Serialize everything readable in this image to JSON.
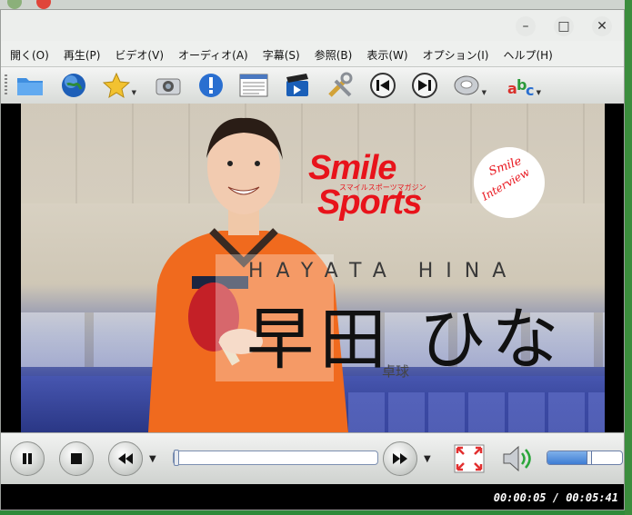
{
  "menu": [
    "開く(O)",
    "再生(P)",
    "ビデオ(V)",
    "オーディオ(A)",
    "字幕(S)",
    "参照(B)",
    "表示(W)",
    "オプション(I)",
    "ヘルプ(H)"
  ],
  "window_buttons": {
    "minimize": "–",
    "maximize": "□",
    "close": "✕"
  },
  "toolbar_icons": [
    "open-folder-icon",
    "globe-icon",
    "favorites-star-icon",
    "screenshot-camera-icon",
    "info-icon",
    "playlist-icon",
    "settings-clapper-icon",
    "preferences-tools-icon",
    "previous-icon",
    "next-icon",
    "audio-disc-icon",
    "subtitles-abc-icon"
  ],
  "video": {
    "logo_line1": "Smile",
    "logo_line2": "Sports",
    "logo_sub": "スマイルスポーツマガジン",
    "badge_line1": "Smile",
    "badge_line2": "Interview",
    "name_roman": "HAYATA HINA",
    "name_jp": "早田 ひな",
    "sport": "卓球"
  },
  "playback": {
    "current": "00:00:05",
    "total": "00:05:41",
    "time_display": "00:00:05 / 00:05:41",
    "progress": 0.015,
    "volume": 0.55
  },
  "colors": {
    "accent_red": "#e8131b",
    "toolbar_bg": "#d8dbd8"
  }
}
